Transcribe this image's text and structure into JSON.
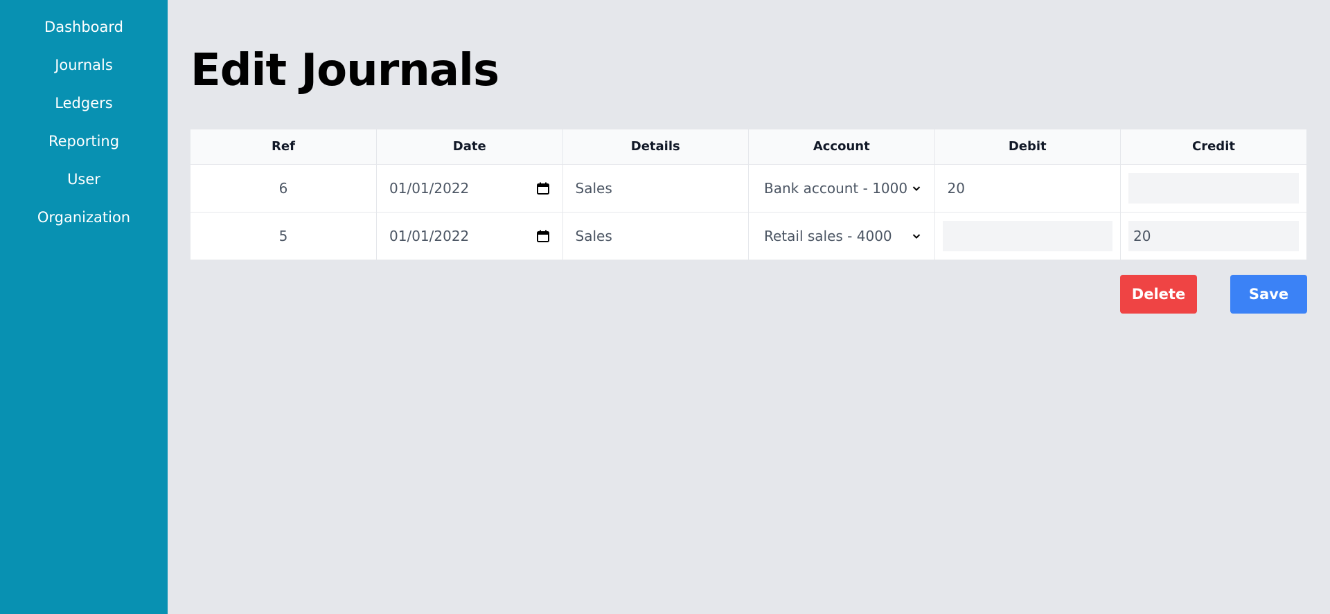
{
  "sidebar": {
    "items": [
      {
        "label": "Dashboard"
      },
      {
        "label": "Journals"
      },
      {
        "label": "Ledgers"
      },
      {
        "label": "Reporting"
      },
      {
        "label": "User"
      },
      {
        "label": "Organization"
      }
    ]
  },
  "page": {
    "title": "Edit Journals"
  },
  "table": {
    "headers": {
      "ref": "Ref",
      "date": "Date",
      "details": "Details",
      "account": "Account",
      "debit": "Debit",
      "credit": "Credit"
    },
    "rows": [
      {
        "ref": "6",
        "date": "01/01/2022",
        "details": "Sales",
        "account": "Bank account - 1000",
        "debit": "20",
        "credit": ""
      },
      {
        "ref": "5",
        "date": "01/01/2022",
        "details": "Sales",
        "account": "Retail sales - 4000",
        "debit": "",
        "credit": "20"
      }
    ]
  },
  "actions": {
    "delete_label": "Delete",
    "save_label": "Save"
  },
  "colors": {
    "sidebar": "#0891b2",
    "background": "#e5e7eb",
    "delete": "#ef4444",
    "save": "#3b82f6"
  }
}
